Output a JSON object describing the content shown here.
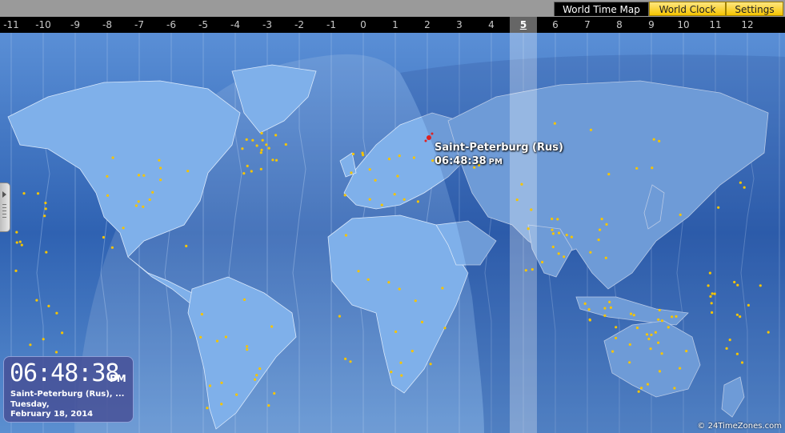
{
  "tabs": [
    {
      "label": "World Time Map",
      "active": true
    },
    {
      "label": "World Clock",
      "active": false
    },
    {
      "label": "Settings",
      "active": false
    }
  ],
  "timezones": [
    "-11",
    "-10",
    "-9",
    "-8",
    "-7",
    "-6",
    "-5",
    "-4",
    "-3",
    "-2",
    "-1",
    "0",
    "1",
    "2",
    "3",
    "4",
    "5",
    "6",
    "7",
    "8",
    "9",
    "10",
    "11",
    "12"
  ],
  "current_timezone": "5",
  "selected_city": {
    "name": "Saint-Peterburg (Rus)",
    "time": "06:48:38",
    "ampm": "PM"
  },
  "clock": {
    "time": "06:48:38",
    "ampm": "PM",
    "city": "Saint-Peterburg (Rus), ...",
    "weekday": "Tuesday,",
    "date": "February 18, 2014"
  },
  "copyright": "© 24TimeZones.com",
  "colors": {
    "ocean": "#3a6db5",
    "land": "#7fb0ea",
    "night": "#2f5aa6",
    "city_dot": "#f5c400",
    "accent_tab": "#f5c400"
  }
}
